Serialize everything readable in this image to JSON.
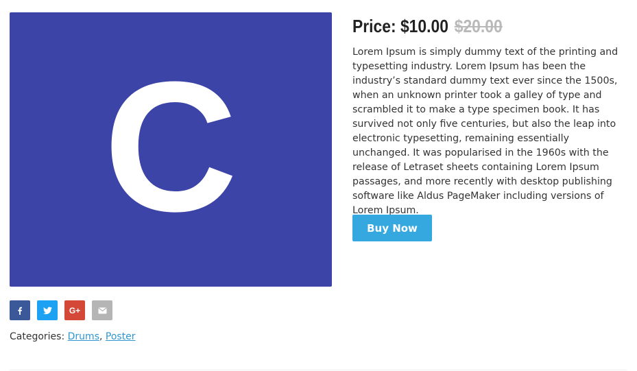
{
  "product": {
    "image_letter": "C",
    "image_color": "#3c44a8",
    "price_label": "Price: $10.00",
    "old_price": "$20.00",
    "description": "Lorem Ipsum is simply dummy text of the printing and typesetting industry. Lorem Ipsum has been the industry’s standard dummy text ever since the 1500s, when an unknown printer took a galley of type and scrambled it to make a type specimen book. It has survived not only five centuries, but also the leap into electronic typesetting, remaining essentially unchanged. It was popularised in the 1960s with the release of Letraset sheets containing Lorem Ipsum passages, and more recently with desktop publishing software like Aldus PageMaker including versions of Lorem Ipsum.",
    "buy_label": "Buy Now",
    "buy_color": "#35a8e0"
  },
  "share": [
    {
      "icon": "facebook-icon",
      "glyph": "f",
      "color": "#3b5998"
    },
    {
      "icon": "twitter-icon",
      "glyph": "t",
      "color": "#1da1f2"
    },
    {
      "icon": "google-plus-icon",
      "glyph": "G+",
      "color": "#d34836"
    },
    {
      "icon": "email-icon",
      "glyph": "env",
      "color": "#b5b5b5"
    }
  ],
  "categories": {
    "label": "Categories:",
    "items": [
      "Drums",
      "Poster"
    ],
    "separator": ","
  }
}
